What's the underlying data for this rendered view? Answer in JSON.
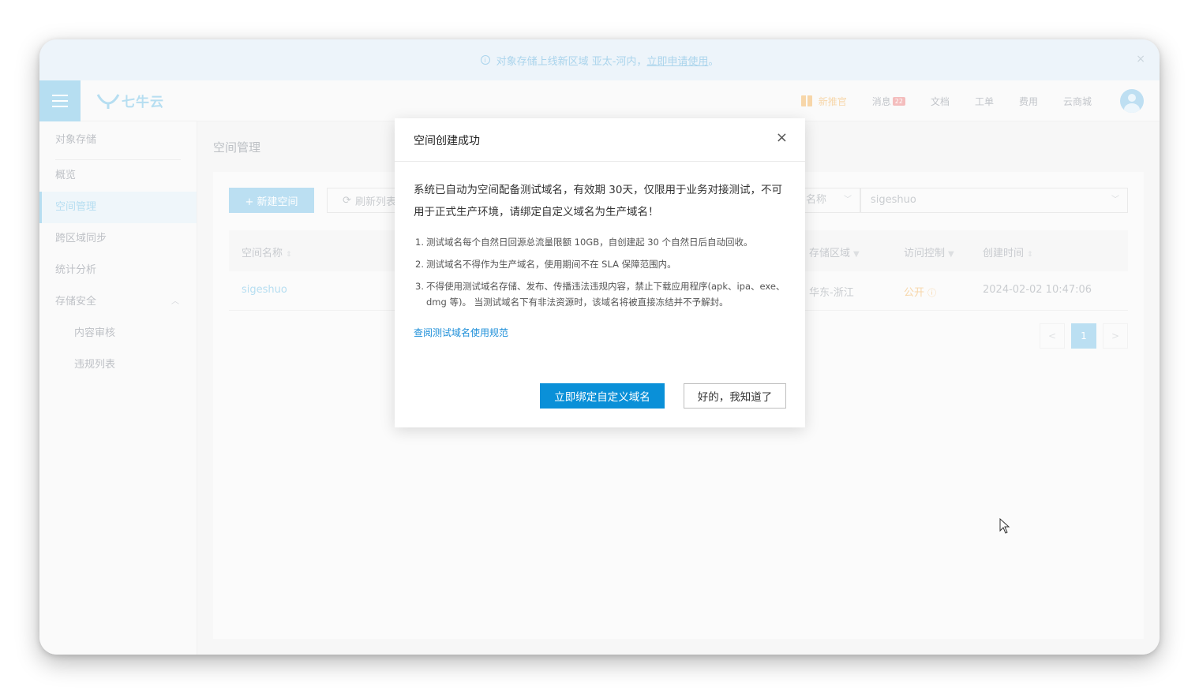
{
  "announcement": {
    "text": "对象存储上线新区域 亚太-河内，",
    "link": "立即申请使用",
    "suffix": "。",
    "close": "×"
  },
  "header": {
    "logo_text": "七牛云",
    "nav": [
      {
        "label": "新推官"
      },
      {
        "label": "消息",
        "badge": "22"
      },
      {
        "label": "文档"
      },
      {
        "label": "工单"
      },
      {
        "label": "费用"
      },
      {
        "label": "云商城"
      }
    ]
  },
  "sidebar": {
    "group_title": "对象存储",
    "items": [
      {
        "label": "概览"
      },
      {
        "label": "空间管理"
      },
      {
        "label": "跨区域同步"
      },
      {
        "label": "统计分析"
      },
      {
        "label": "存储安全"
      },
      {
        "label": "内容审核"
      },
      {
        "label": "违规列表"
      }
    ]
  },
  "main": {
    "page_title": "空间管理",
    "new_button": "+ 新建空间",
    "refresh_button": "刷新列表",
    "filter_select": "名称",
    "search_value": "sigeshuo",
    "columns": {
      "name": "空间名称",
      "region": "存储区域",
      "access": "访问控制",
      "created": "创建时间"
    },
    "row": {
      "name": "sigeshuo",
      "region": "华东-浙江",
      "access": "公开",
      "created": "2024-02-02 10:47:06"
    },
    "pagination": {
      "prev": "<",
      "current": "1",
      "next": ">"
    }
  },
  "modal": {
    "title": "空间创建成功",
    "close": "×",
    "lead": "系统已自动为空间配备测试域名，有效期 30天，仅限用于业务对接测试，不可用于正式生产环境，请绑定自定义域名为生产域名！",
    "list": [
      {
        "num": "1.",
        "text": "测试域名每个自然日回源总流量限额 10GB，自创建起 30 个自然日后自动回收。"
      },
      {
        "num": "2.",
        "text": "测试域名不得作为生产域名，使用期间不在 SLA 保障范围内。"
      },
      {
        "num": "3.",
        "text": "不得使用测试域名存储、发布、传播违法违规内容，禁止下载应用程序(apk、ipa、exe、dmg 等)。 当测试域名下有非法资源时，该域名将被直接冻结并不予解封。"
      }
    ],
    "link": "查阅测试域名使用规范",
    "primary_button": "立即绑定自定义域名",
    "secondary_button": "好的，我知道了"
  }
}
